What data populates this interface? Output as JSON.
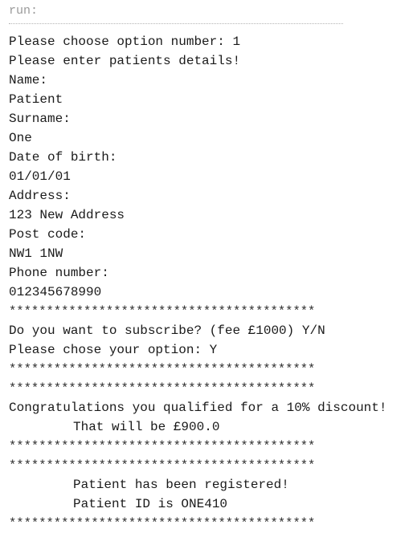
{
  "console": {
    "run_label": "run:",
    "lines": [
      "Please choose option number: 1",
      "Please enter patients details!",
      "Name:",
      "Patient",
      "Surname:",
      "One",
      "Date of birth:",
      "01/01/01",
      "Address:",
      "123 New Address",
      "Post code:",
      "NW1 1NW",
      "Phone number:",
      "012345678990",
      "*****************************************",
      "Do you want to subscribe? (fee £1000) Y/N",
      "Please chose your option: Y",
      "*****************************************",
      "*****************************************",
      "Congratulations you qualified for a 10% discount!",
      "That will be £900.0",
      "*****************************************",
      "*****************************************",
      "Patient has been registered!",
      "Patient ID is ONE410",
      "*****************************************"
    ]
  }
}
